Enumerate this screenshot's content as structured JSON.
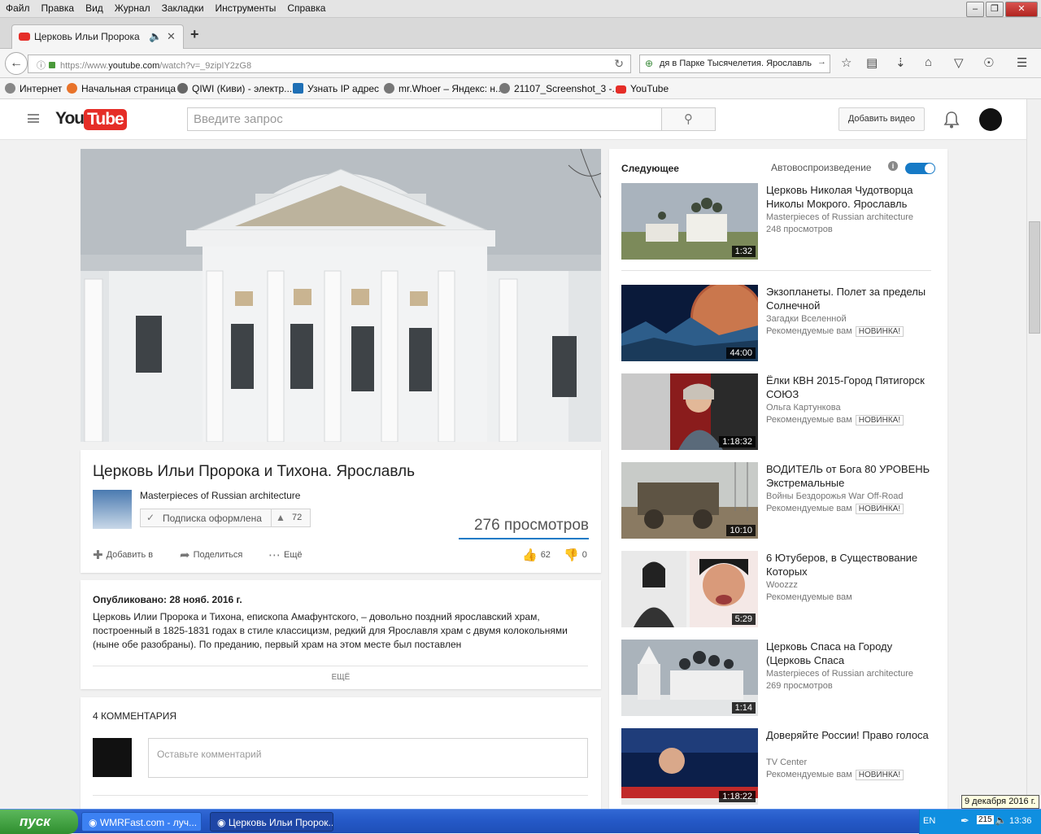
{
  "browser": {
    "menu": [
      "Файл",
      "Правка",
      "Вид",
      "Журнал",
      "Закладки",
      "Инструменты",
      "Справка"
    ],
    "tab_title": "Церковь Ильи Пророка ...",
    "new_tab": "+",
    "url_prefix": "https://www.",
    "url_domain": "youtube.com",
    "url_rest": "/watch?v=_9zipIY2zG8",
    "search_text": "дя в Парке Тысячелетия. Ярославль",
    "bookmarks": [
      "Интернет",
      "Начальная страница",
      "QIWI (Киви) - электр...",
      "Узнать IP адрес",
      "mr.Whoer – Яндекс: н...",
      "21107_Screenshot_3 -...",
      "YouTube"
    ]
  },
  "youtube": {
    "logo_you": "You",
    "logo_tube": "Tube",
    "search_placeholder": "Введите запрос",
    "upload_label": "Добавить видео"
  },
  "video": {
    "title": "Церковь Ильи Пророка и Тихона. Ярославль",
    "channel": "Masterpieces of Russian architecture",
    "subscribe_label": "Подписка оформлена",
    "subscriber_count": "72",
    "views": "276 просмотров",
    "add_to": "Добавить в",
    "share": "Поделиться",
    "more": "Ещё",
    "likes": "62",
    "dislikes": "0"
  },
  "description": {
    "published": "Опубликовано: 28 нояб. 2016 г.",
    "text": "Церковь Илии Пророка и Тихона, епископа Амафунтского, – довольно поздний ярославский храм, построенный в 1825-1831 годах в стиле классицизм, редкий для Ярославля храм с двумя колокольнями (ныне обе разобраны). По преданию, первый храм на этом месте был поставлен",
    "more_label": "ЕЩЁ"
  },
  "comments": {
    "header": "4 КОММЕНТАРИЯ",
    "placeholder": "Оставьте комментарий"
  },
  "sidebar": {
    "next_label": "Следующее",
    "autoplay_label": "Автовоспроизведение",
    "info_icon": "i",
    "videos": [
      {
        "title": "Церковь Николая Чудотворца Николы Мокрого. Ярославль",
        "channel": "Masterpieces of Russian architecture",
        "meta": "248 просмотров",
        "badge": "",
        "duration": "1:32"
      },
      {
        "title": "Экзопланеты. Полет за пределы Солнечной",
        "channel": "Загадки Вселенной",
        "meta": "Рекомендуемые вам",
        "badge": "НОВИНКА!",
        "duration": "44:00"
      },
      {
        "title": "Ёлки КВН 2015-Город Пятигорск СОЮЗ",
        "channel": "Ольга Картункова",
        "meta": "Рекомендуемые вам",
        "badge": "НОВИНКА!",
        "duration": "1:18:32"
      },
      {
        "title": "ВОДИТЕЛЬ от Бога 80 УРОВЕНЬ Экстремальные",
        "channel": "Войны Бездорожья War Off-Road",
        "meta": "Рекомендуемые вам",
        "badge": "НОВИНКА!",
        "duration": "10:10"
      },
      {
        "title": "6 Ютуберов, в Существование Которых",
        "channel": "Woozzz",
        "meta": "Рекомендуемые вам",
        "badge": "",
        "duration": "5:29"
      },
      {
        "title": "Церковь Спаса на Городу (Церковь Спаса",
        "channel": "Masterpieces of Russian architecture",
        "meta": "269 просмотров",
        "badge": "",
        "duration": "1:14"
      },
      {
        "title": "Доверяйте России! Право голоса",
        "channel": "TV Center",
        "meta": "Рекомендуемые вам",
        "badge": "НОВИНКА!",
        "duration": "1:18:22"
      }
    ]
  },
  "taskbar": {
    "start_label": "пуск",
    "tasks": [
      "WMRFast.com - луч...",
      "Церковь Ильи Пророк..."
    ],
    "lang": "EN",
    "time": "13:36",
    "tray_num": "215",
    "date_tooltip": "9 декабря 2016 г."
  }
}
